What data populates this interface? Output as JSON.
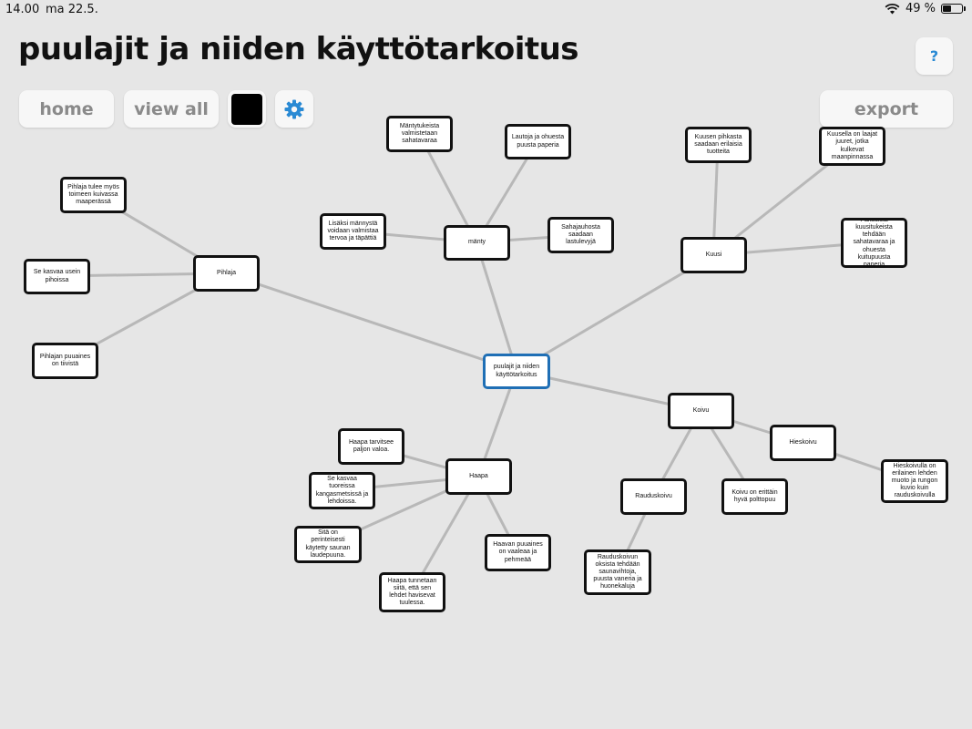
{
  "status": {
    "time": "14.00",
    "date": "ma 22.5.",
    "battery": "49 %",
    "battery_level": 0.49
  },
  "title": "puulajit ja niiden käyttötarkoitus",
  "toolbar": {
    "home": "home",
    "view_all": "view all",
    "export": "export",
    "help": "?",
    "color": "#000000"
  },
  "colors": {
    "background": "#e6e6e6",
    "edge": "#b8b8b8",
    "node_border": "#111111",
    "center_border": "#1f6fb5",
    "settings": "#2a8ad4"
  },
  "map": {
    "center": "puulajit ja niiden käyttötarkoitus",
    "branches": [
      {
        "label": "mänty",
        "children": [
          "Mäntytukeista valmistetaan sahatavaraa",
          "Lautoja ja ohuesta puusta paperia",
          "Sahajauhosta saadaan lastulevyjä",
          "Lisäksi männystä voidaan valmistaa tervoa ja täpättiä"
        ]
      },
      {
        "label": "Kuusi",
        "children": [
          "Kuusen pihkasta saadaan erilaisia tuotteita",
          "Kuusella on laajat juuret, jotka kulkevat maanpinnassa",
          "Paksuista kuusitukeista tehdään sahatavaraa ja ohuesta kuitupuusta paperia"
        ]
      },
      {
        "label": "Pihlaja",
        "children": [
          "Pihlaja tulee myös toimeen kuivassa maaperässä",
          "Se kasvaa usein pihoissa",
          "Pihlajan puuaines on tiivistä"
        ]
      },
      {
        "label": "Koivu",
        "children": [
          "Hieskoivu",
          "Rauduskoivu",
          "Koivu on erittäin hyvä polttopuu"
        ]
      },
      {
        "label": "Haapa",
        "children": [
          "Haapa tarvitsee paljon valoa.",
          "Se kasvaa tuoreissa kangasmetsissä ja lehdoissa.",
          "Sitä on perinteisesti käytetty saunan laudepuuna.",
          "Haapa tunnetaan siitä, että sen lehdet havisevat tuulessa.",
          "Haavan puuaines on vaaleaa ja pehmeää"
        ]
      }
    ],
    "leaves": {
      "hieskoivu_note": "Hieskoivulla on erilainen lehden muoto ja rungon kuvio kuin rauduskoivulla",
      "rauduskoivu_note": "Rauduskoivun oksista tehdään saunavihtoja, puusta vaneria ja huonekaluja"
    }
  }
}
